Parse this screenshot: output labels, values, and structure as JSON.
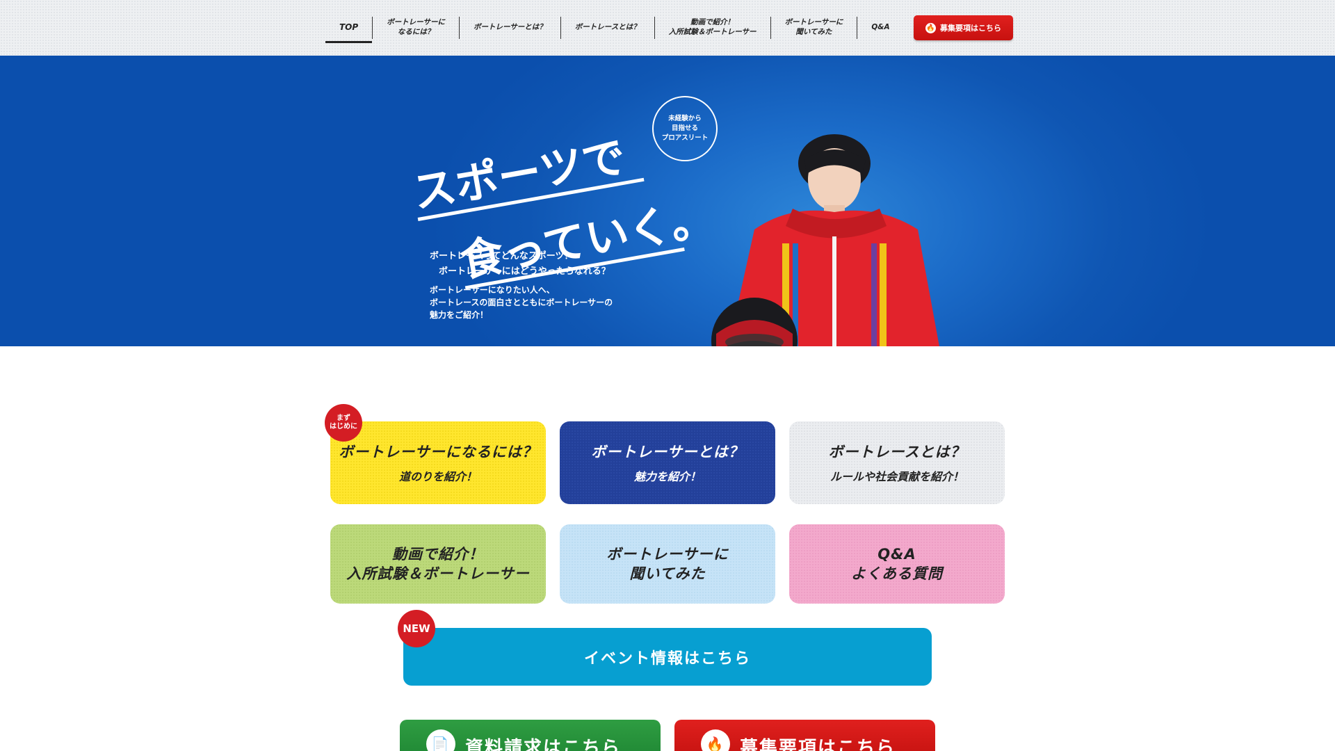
{
  "nav": {
    "items": [
      {
        "label": "TOP",
        "active": true
      },
      {
        "label": "ボートレーサーに\nなるには？"
      },
      {
        "label": "ボートレーサーとは？"
      },
      {
        "label": "ボートレースとは？"
      },
      {
        "label": "動画で紹介！\n入所試験＆ボートレーサー"
      },
      {
        "label": "ボートレーサーに\n聞いてみた"
      },
      {
        "label": "Q&A"
      }
    ],
    "cta_label": "募集要項はこちら",
    "cta_icon": "flame-icon"
  },
  "hero": {
    "title_line1": "スポーツで",
    "title_line2": "食っていく。",
    "badge": "未経験から\n目指せる\nプロアスリート",
    "lead": "ボートレースってどんなスポーツ？\n　ボートレーサーにはどうやったらなれる？",
    "description": "ボートレーサーになりたい人へ、\nボートレースの面白さとともにボートレーサーの\n魅力をご紹介！"
  },
  "cards": {
    "become": {
      "title": "ボートレーサーになるには？",
      "sub": "道のりを紹介！",
      "badge": "まず\nはじめに"
    },
    "about_racer": {
      "title": "ボートレーサーとは？",
      "sub": "魅力を紹介！"
    },
    "about_race": {
      "title": "ボートレースとは？",
      "sub": "ルールや社会貢献を紹介！"
    },
    "video": {
      "title": "動画で紹介！\n入所試験＆ボートレーサー"
    },
    "interview": {
      "title": "ボートレーサーに\n聞いてみた"
    },
    "qa": {
      "title": "Q&A\nよくある質問"
    }
  },
  "event": {
    "label": "イベント情報はこちら",
    "badge": "NEW"
  },
  "bottom": {
    "request_label": "資料請求はこちら",
    "recruit_label": "募集要項はこちら"
  },
  "colors": {
    "brand_blue": "#0f56b3",
    "cta_red": "#d0141a",
    "event_blue": "#079fd1",
    "request_green": "#1e8633"
  }
}
